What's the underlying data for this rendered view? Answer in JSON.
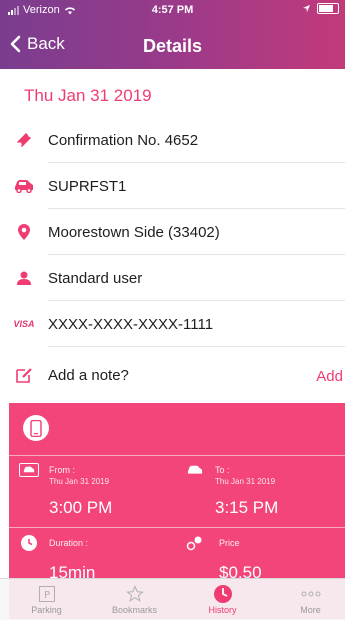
{
  "status": {
    "carrier": "Verizon",
    "time": "4:57 PM"
  },
  "nav": {
    "back_label": "Back",
    "title": "Details"
  },
  "date": "Thu Jan 31 2019",
  "details": [
    {
      "icon": "ticket-icon",
      "text": "Confirmation No. 4652"
    },
    {
      "icon": "car-icon",
      "text": "SUPRFST1"
    },
    {
      "icon": "location-pin-icon",
      "text": "Moorestown Side (33402)"
    },
    {
      "icon": "user-icon",
      "text": "Standard user"
    },
    {
      "icon": "visa-icon",
      "text": "XXXX-XXXX-XXXX-1111",
      "badge": "VISA"
    }
  ],
  "note": {
    "label": "Add a note?",
    "action": "Add"
  },
  "session": {
    "from_label": "From :",
    "from_date": "Thu Jan 31 2019",
    "from_time": "3:00 PM",
    "to_label": "To :",
    "to_date": "Thu Jan 31 2019",
    "to_time": "3:15 PM",
    "duration_label": "Duration :",
    "duration_value": "15min",
    "price_label": "Price",
    "price_value": "$0.50"
  },
  "tabs": [
    {
      "label": "Parking",
      "icon": "parking-icon"
    },
    {
      "label": "Bookmarks",
      "icon": "star-icon"
    },
    {
      "label": "History",
      "icon": "clock-icon",
      "active": true
    },
    {
      "label": "More",
      "icon": "more-icon"
    }
  ],
  "colors": {
    "accent": "#ef3d72",
    "card": "#f4457a",
    "header_start": "#7a3d8e",
    "header_end": "#c23a7a"
  }
}
